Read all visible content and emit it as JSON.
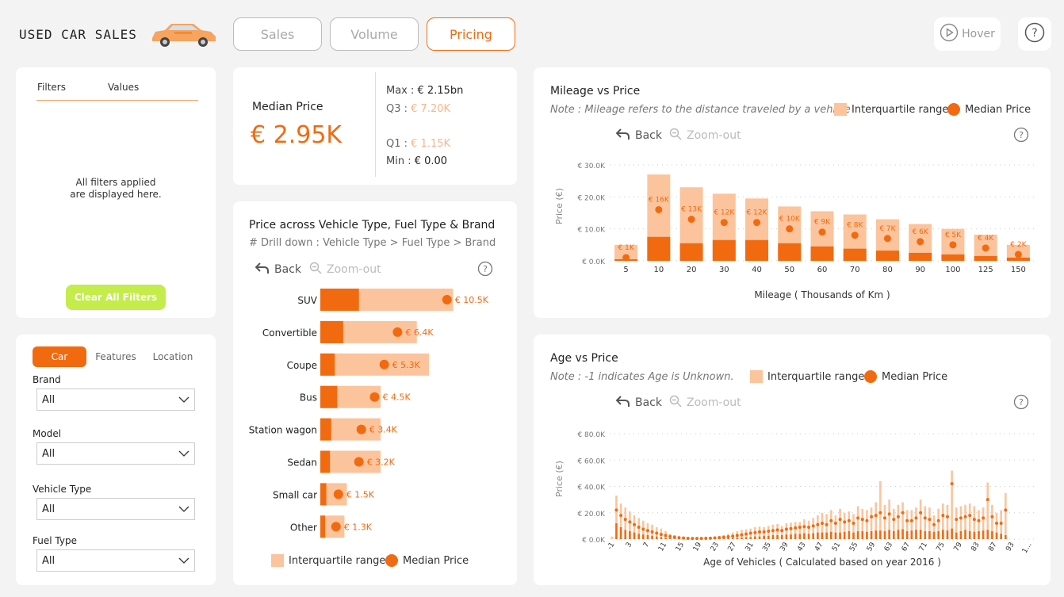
{
  "app": {
    "title": "USED CAR SALES",
    "nav": [
      {
        "label": "Sales",
        "active": false
      },
      {
        "label": "Volume",
        "active": false
      },
      {
        "label": "Pricing",
        "active": true
      }
    ],
    "hover_label": "Hover"
  },
  "colors": {
    "accent": "#f26a10",
    "iqr": "#fbc49c",
    "clear_button": "#c4ec4a"
  },
  "filters_pane": {
    "col_filters": "Filters",
    "col_values": "Values",
    "empty_message": "All filters applied\nare displayed here.",
    "clear_button": "Clear All Filters"
  },
  "slicer": {
    "tabs": [
      "Car",
      "Features",
      "Location"
    ],
    "active_tab": "Car",
    "fields": [
      {
        "label": "Brand",
        "value": "All"
      },
      {
        "label": "Model",
        "value": "All"
      },
      {
        "label": "Vehicle Type",
        "value": "All"
      },
      {
        "label": "Fuel Type",
        "value": "All"
      }
    ]
  },
  "kpi": {
    "label": "Median Price",
    "value": "€ 2.95K",
    "max_label": "Max :",
    "max_value": "€ 2.15bn",
    "q3_label": "Q3 :",
    "q3_value": "€ 7.20K",
    "q1_label": "Q1 :",
    "q1_value": "€ 1.15K",
    "min_label": "Min :",
    "min_value": "€ 0.00"
  },
  "toolbar": {
    "back": "Back",
    "zoom_out": "Zoom-out"
  },
  "legend": {
    "iqr": "Interquartile range",
    "median": "Median Price"
  },
  "vehicle_chart": {
    "title": "Price across Vehicle Type, Fuel Type & Brand",
    "subtitle": "# Drill down : Vehicle Type > Fuel Type > Brand"
  },
  "mileage_chart": {
    "title": "Mileage vs Price",
    "note": "Note : Mileage refers to the distance traveled by a vehicle"
  },
  "age_chart": {
    "title": "Age vs Price",
    "note": "Note : -1 indicates Age is Unknown."
  },
  "chart_data": [
    {
      "id": "vehicle_type",
      "type": "bar",
      "orientation": "horizontal",
      "categories": [
        "SUV",
        "Convertible",
        "Coupe",
        "Bus",
        "Station wagon",
        "Sedan",
        "Small car",
        "Other"
      ],
      "series": [
        {
          "name": "Interquartile range",
          "q1": [
            3200,
            1900,
            1200,
            1400,
            900,
            800,
            500,
            400
          ],
          "q3": [
            11000,
            8000,
            9000,
            5000,
            5000,
            5000,
            2200,
            2000
          ]
        },
        {
          "name": "Median Price",
          "values": [
            10500,
            6400,
            5300,
            4500,
            3400,
            3200,
            1500,
            1300
          ]
        }
      ],
      "data_labels": [
        "€ 10.5K",
        "€ 6.4K",
        "€ 5.3K",
        "€ 4.5K",
        "€ 3.4K",
        "€ 3.2K",
        "€ 1.5K",
        "€ 1.3K"
      ],
      "xlim": [
        0,
        11500
      ]
    },
    {
      "id": "mileage",
      "type": "bar",
      "xlabel": "Mileage ( Thousands of Km )",
      "ylabel": "Price (€)",
      "categories": [
        "5",
        "10",
        "20",
        "30",
        "40",
        "50",
        "60",
        "70",
        "80",
        "90",
        "100",
        "125",
        "150"
      ],
      "series": [
        {
          "name": "Interquartile range",
          "q1": [
            500,
            7500,
            5500,
            6500,
            6500,
            5500,
            4500,
            3800,
            3200,
            2500,
            2000,
            1500,
            1000
          ],
          "q3": [
            5000,
            27000,
            23000,
            21000,
            19500,
            17000,
            15500,
            14500,
            13000,
            11500,
            10000,
            8200,
            5000
          ]
        },
        {
          "name": "Median Price",
          "values": [
            1000,
            16000,
            13000,
            12000,
            12000,
            10000,
            9000,
            8000,
            7000,
            6000,
            5000,
            4000,
            2000
          ]
        }
      ],
      "data_labels": [
        "€ 1K",
        "€ 16K",
        "€ 13K",
        "€ 12K",
        "€ 12K",
        "€ 10K",
        "€ 9K",
        "€ 8K",
        "€ 7K",
        "€ 6K",
        "€ 5K",
        "€ 4K",
        "€ 2K"
      ],
      "y_ticks": [
        "€ 0.0K",
        "€ 10.0K",
        "€ 20.0K",
        "€ 30.0K"
      ],
      "ylim": [
        0,
        30000
      ],
      "grid": true
    },
    {
      "id": "age",
      "type": "bar",
      "xlabel": "Age of Vehicles ( Calculated based on year 2016 )",
      "ylabel": "Price (€)",
      "x_tick_labels": [
        "-1",
        "3",
        "7",
        "11",
        "15",
        "19",
        "23",
        "27",
        "31",
        "35",
        "39",
        "43",
        "47",
        "51",
        "55",
        "59",
        "63",
        "67",
        "71",
        "75",
        "79",
        "83",
        "87",
        "93",
        "1..."
      ],
      "categories": [
        "-1",
        "0",
        "1",
        "2",
        "3",
        "4",
        "5",
        "6",
        "7",
        "8",
        "9",
        "10",
        "11",
        "12",
        "13",
        "14",
        "15",
        "16",
        "17",
        "18",
        "19",
        "20",
        "21",
        "22",
        "23",
        "24",
        "25",
        "26",
        "27",
        "28",
        "29",
        "30",
        "31",
        "32",
        "33",
        "34",
        "35",
        "36",
        "37",
        "38",
        "39",
        "40",
        "41",
        "42",
        "43",
        "44",
        "45",
        "46",
        "47",
        "48",
        "49",
        "50",
        "51",
        "52",
        "53",
        "54",
        "55",
        "56",
        "57",
        "58",
        "59",
        "60",
        "61",
        "62",
        "63",
        "64",
        "65",
        "66",
        "67",
        "68",
        "69",
        "70",
        "71",
        "72",
        "73",
        "74",
        "75",
        "76",
        "77",
        "78",
        "79",
        "80",
        "81",
        "82",
        "83",
        "84",
        "85",
        "86",
        "87",
        "88",
        "89",
        "90",
        "91",
        "93",
        "1..."
      ],
      "series": [
        {
          "name": "Interquartile range",
          "q1": [
            0,
            12000,
            9000,
            7000,
            6000,
            5000,
            4000,
            3500,
            3000,
            2500,
            2000,
            1500,
            1000,
            800,
            600,
            500,
            400,
            300,
            300,
            300,
            300,
            300,
            300,
            300,
            500,
            500,
            600,
            800,
            1000,
            1200,
            1500,
            1500,
            2000,
            2000,
            2500,
            2500,
            3000,
            3000,
            3000,
            3500,
            3500,
            4000,
            4000,
            4500,
            4000,
            4500,
            5000,
            5000,
            5000,
            5500,
            5000,
            5000,
            5500,
            6000,
            5000,
            6000,
            6000,
            5500,
            6000,
            6500,
            6500,
            6000,
            7000,
            6000,
            7000,
            7500,
            6000,
            6500,
            7000,
            7000,
            6000,
            6000,
            5500,
            6000,
            7000,
            6500,
            8000,
            5000,
            6000,
            7000,
            6000,
            5500,
            6000,
            6500,
            7000,
            6000,
            5000,
            4000,
            3000,
            0,
            0,
            0,
            0,
            0,
            0,
            0
          ],
          "q3": [
            2000,
            33000,
            27000,
            24000,
            21000,
            18000,
            16000,
            14000,
            12000,
            11000,
            9000,
            8000,
            6000,
            4000,
            3000,
            2500,
            2000,
            1500,
            1500,
            1200,
            1200,
            1500,
            1500,
            2000,
            2500,
            3000,
            4000,
            5000,
            6000,
            7000,
            7500,
            8000,
            9000,
            9500,
            9000,
            10000,
            11000,
            11500,
            10000,
            12000,
            12500,
            13000,
            13000,
            15000,
            14000,
            16000,
            18000,
            20000,
            19000,
            22000,
            18000,
            23000,
            20000,
            21000,
            19000,
            25000,
            23000,
            22000,
            24000,
            28000,
            44000,
            26000,
            30000,
            23000,
            26000,
            28000,
            22000,
            22000,
            24000,
            30000,
            25000,
            24000,
            18000,
            23000,
            27000,
            26000,
            52000,
            24000,
            25000,
            26000,
            27000,
            25000,
            22000,
            24000,
            43000,
            26000,
            20000,
            22000,
            35000,
            0,
            0,
            0,
            0,
            0,
            0,
            0
          ]
        },
        {
          "name": "Median Price",
          "values": [
            0,
            22000,
            18000,
            15000,
            13000,
            11000,
            9000,
            7500,
            6500,
            5500,
            4500,
            3500,
            2800,
            2000,
            1500,
            1000,
            800,
            600,
            500,
            500,
            500,
            600,
            700,
            900,
            1100,
            1400,
            1800,
            2200,
            2800,
            3200,
            3800,
            4500,
            5000,
            5500,
            5500,
            6000,
            6500,
            7000,
            6500,
            7500,
            8000,
            8500,
            9000,
            9500,
            9000,
            10000,
            11000,
            12000,
            11000,
            14000,
            12000,
            15000,
            13000,
            14000,
            12000,
            16000,
            15000,
            14000,
            17000,
            18000,
            20000,
            16000,
            19000,
            15000,
            17000,
            20000,
            14000,
            14000,
            16000,
            20000,
            16000,
            15000,
            11000,
            14000,
            18000,
            17000,
            42000,
            15000,
            16000,
            17000,
            18000,
            15000,
            14000,
            16000,
            30000,
            17000,
            12000,
            12000,
            22000,
            0,
            0,
            0,
            0,
            0,
            0,
            0
          ]
        }
      ],
      "y_ticks": [
        "€ 0.0K",
        "€ 20.0K",
        "€ 40.0K",
        "€ 60.0K",
        "€ 80.0K"
      ],
      "ylim": [
        0,
        80000
      ],
      "grid": true
    }
  ]
}
